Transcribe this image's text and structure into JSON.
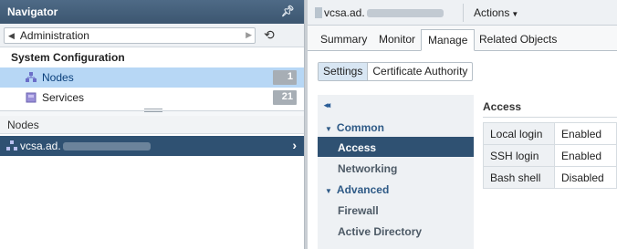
{
  "navigator": {
    "title": "Navigator",
    "back_label": "Administration",
    "section_title": "System Configuration",
    "items": [
      {
        "label": "Nodes",
        "count": "1"
      },
      {
        "label": "Services",
        "count": "21"
      }
    ],
    "nodes_header": "Nodes",
    "node_row_label": "vcsa.ad."
  },
  "main": {
    "object_name": "vcsa.ad.",
    "actions_label": "Actions",
    "tabs": [
      {
        "label": "Summary"
      },
      {
        "label": "Monitor"
      },
      {
        "label": "Manage"
      },
      {
        "label": "Related Objects"
      }
    ],
    "subtabs": [
      {
        "label": "Settings"
      },
      {
        "label": "Certificate Authority"
      }
    ],
    "sidebar": {
      "collapse_glyph": "◂◂",
      "groups": [
        {
          "label": "Common"
        },
        {
          "label": "Advanced"
        }
      ],
      "items": [
        {
          "label": "Access"
        },
        {
          "label": "Networking"
        },
        {
          "label": "Firewall"
        },
        {
          "label": "Active Directory"
        }
      ]
    },
    "access": {
      "title": "Access",
      "rows": [
        {
          "key": "Local login",
          "value": "Enabled"
        },
        {
          "key": "SSH login",
          "value": "Enabled"
        },
        {
          "key": "Bash shell",
          "value": "Disabled"
        }
      ]
    }
  },
  "colors": {
    "header_bg": "#3c5670",
    "selected_row": "#2f5172",
    "selected_light": "#b7d7f5",
    "link_blue": "#2e5a86"
  }
}
